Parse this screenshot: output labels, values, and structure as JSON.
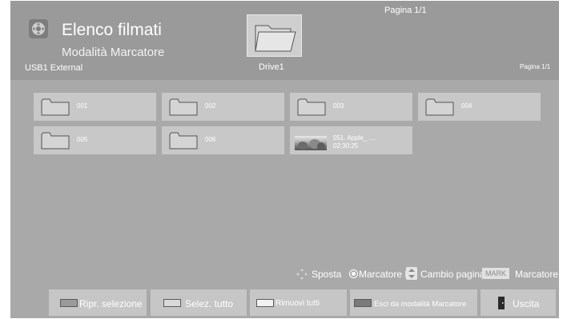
{
  "header": {
    "title": "Elenco filmati",
    "mode": "Modalità Marcatore",
    "device": "USB1 External",
    "drive": "Drive1",
    "page_top": "Pagina 1/1",
    "page_right": "Pagina 1/1"
  },
  "files": [
    {
      "name": "001",
      "type": "folder"
    },
    {
      "name": "002",
      "type": "folder"
    },
    {
      "name": "003",
      "type": "folder"
    },
    {
      "name": "004",
      "type": "folder"
    },
    {
      "name": "005",
      "type": "folder"
    },
    {
      "name": "006",
      "type": "folder"
    },
    {
      "name": "051. Apple_ ....",
      "duration": "02:30:25",
      "type": "video"
    }
  ],
  "helper": {
    "move": "Sposta",
    "marker": "Marcatore",
    "page_key": "P",
    "page": "Cambio pagina",
    "mark_key": "MARK",
    "mark": "Marcatore"
  },
  "buttons": {
    "restore": "Ripr. selezione",
    "select_all": "Selez. tutto",
    "remove_all": "Rimuovi tutti",
    "exit_mark": "Esci da modalità Marcatore",
    "exit": "Uscita"
  },
  "colors": {
    "red_key": "#9a9a9a",
    "green_key": "#d9d9d9",
    "yellow_key": "#f2f2f2",
    "blue_key": "#7a7a7a"
  }
}
